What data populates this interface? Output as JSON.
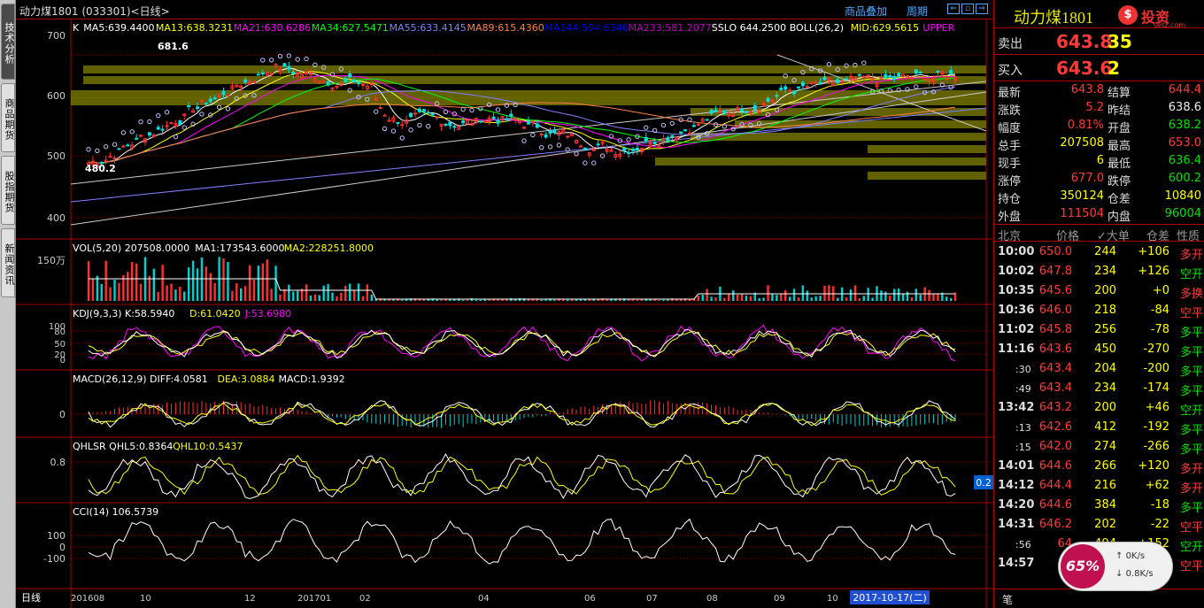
{
  "left_tabs": [
    "技术分析",
    "商品期货",
    "股指期货",
    "新闻资讯"
  ],
  "chart": {
    "title": "动力煤1801 (033301)<日线>",
    "links": [
      "商品叠加",
      "周期"
    ],
    "ma_legend": [
      {
        "text": "K",
        "color": "#ffffff"
      },
      {
        "text": "MA5:639.4400",
        "color": "#ffffff"
      },
      {
        "text": "MA13:638.3231",
        "color": "#ffff00"
      },
      {
        "text": "MA21:630.6286",
        "color": "#ff00ff"
      },
      {
        "text": "MA34:627.5471",
        "color": "#00ff00"
      },
      {
        "text": "MA55:633.4145",
        "color": "#8080ff"
      },
      {
        "text": "MA89:615.4360",
        "color": "#ff8040"
      },
      {
        "text": "MA144:594.6346",
        "color": "#0000ff"
      },
      {
        "text": "MA233:581.2077",
        "color": "#c000c0"
      },
      {
        "text": "SSLO 644.2500",
        "color": "#ffffff"
      },
      {
        "text": "BOLL(26,2)",
        "color": "#ffffff"
      },
      {
        "text": "MID:629.5615",
        "color": "#ffff00"
      },
      {
        "text": "UPPER",
        "color": "#ff00ff"
      }
    ],
    "price_axis": [
      "700",
      "600",
      "500",
      "400"
    ],
    "price_marks": {
      "high": "681.6",
      "low": "480.2"
    },
    "vol_legend": [
      {
        "text": "VOL(5,20) 207508.0000",
        "color": "#ffffff"
      },
      {
        "text": "MA1:173543.6000",
        "color": "#ffffff"
      },
      {
        "text": "MA2:228251.8000",
        "color": "#ffff00"
      }
    ],
    "vol_axis": "150万",
    "kdj_legend": [
      {
        "text": "KDJ(9,3,3) K:58.5940",
        "color": "#ffffff"
      },
      {
        "text": "D:61.0420",
        "color": "#ffff00"
      },
      {
        "text": "J:53.6980",
        "color": "#ff00ff"
      }
    ],
    "kdj_axis": [
      "100",
      "80",
      "50",
      "20",
      "0"
    ],
    "macd_legend": [
      {
        "text": "MACD(26,12,9) DIFF:4.0581",
        "color": "#ffffff"
      },
      {
        "text": "DEA:3.0884",
        "color": "#ffff00"
      },
      {
        "text": "MACD:1.9392",
        "color": "#ffffff"
      }
    ],
    "macd_axis": "0",
    "qhlsr_legend": [
      {
        "text": "QHLSR QHL5:0.8364",
        "color": "#ffffff"
      },
      {
        "text": "QHL10:0.5437",
        "color": "#ffff00"
      }
    ],
    "qhlsr_axis": "0.8",
    "qhlsr_marker": "0.2",
    "cci_legend": [
      {
        "text": "CCI(14) 106.5739",
        "color": "#ffffff"
      }
    ],
    "cci_axis": [
      "100",
      "0",
      "-100"
    ],
    "date_axis_label": "日线",
    "date_ticks": [
      "201608",
      "10",
      "12",
      "201701",
      "02",
      "04",
      "06",
      "07",
      "08",
      "09",
      "10"
    ],
    "date_highlight": "2017-10-17(二)"
  },
  "quote": {
    "name": "动力煤1801",
    "logo_brand": "投资",
    "logo_sub": "setz.com",
    "sell": {
      "label": "卖出",
      "price": "643.8",
      "vol": "35"
    },
    "buy": {
      "label": "买入",
      "price": "643.6",
      "vol": "2"
    },
    "stats": [
      {
        "l1": "最新",
        "v1": "643.8",
        "c1": "red",
        "l2": "结算",
        "v2": "644.4",
        "c2": "red"
      },
      {
        "l1": "涨跌",
        "v1": "5.2",
        "c1": "red",
        "l2": "昨结",
        "v2": "638.6",
        "c2": "white"
      },
      {
        "l1": "幅度",
        "v1": "0.81%",
        "c1": "red",
        "l2": "开盘",
        "v2": "638.2",
        "c2": "green"
      },
      {
        "l1": "总手",
        "v1": "207508",
        "c1": "yellow",
        "l2": "最高",
        "v2": "653.0",
        "c2": "red"
      },
      {
        "l1": "现手",
        "v1": "6",
        "c1": "yellow",
        "l2": "最低",
        "v2": "636.4",
        "c2": "green"
      },
      {
        "l1": "涨停",
        "v1": "677.0",
        "c1": "red",
        "l2": "跌停",
        "v2": "600.2",
        "c2": "green"
      },
      {
        "l1": "持仓",
        "v1": "350124",
        "c1": "yellow",
        "l2": "仓差",
        "v2": "10840",
        "c2": "yellow"
      },
      {
        "l1": "外盘",
        "v1": "111504",
        "c1": "red",
        "l2": "内盘",
        "v2": "96004",
        "c2": "green"
      }
    ],
    "trade_header": [
      "北京",
      "价格",
      "✓大单",
      "仓差",
      "性质"
    ],
    "trades": [
      {
        "t": "10:00",
        "s": false,
        "p": "650.0",
        "pc": "red",
        "v": "244",
        "d": "+106",
        "dc": "yellow",
        "n": "多开",
        "nc": "red"
      },
      {
        "t": "10:02",
        "s": false,
        "p": "647.8",
        "pc": "red",
        "v": "234",
        "d": "+126",
        "dc": "yellow",
        "n": "空开",
        "nc": "green"
      },
      {
        "t": "10:35",
        "s": false,
        "p": "645.6",
        "pc": "red",
        "v": "200",
        "d": "+0",
        "dc": "yellow",
        "n": "多换",
        "nc": "red"
      },
      {
        "t": "10:36",
        "s": false,
        "p": "646.0",
        "pc": "red",
        "v": "218",
        "d": "-84",
        "dc": "yellow",
        "n": "空平",
        "nc": "red"
      },
      {
        "t": "11:02",
        "s": false,
        "p": "645.8",
        "pc": "red",
        "v": "256",
        "d": "-78",
        "dc": "yellow",
        "n": "多平",
        "nc": "green"
      },
      {
        "t": "11:16",
        "s": false,
        "p": "643.6",
        "pc": "red",
        "v": "450",
        "d": "-270",
        "dc": "yellow",
        "n": "多平",
        "nc": "green"
      },
      {
        "t": ":30",
        "s": true,
        "p": "643.4",
        "pc": "red",
        "v": "204",
        "d": "-200",
        "dc": "yellow",
        "n": "多平",
        "nc": "green"
      },
      {
        "t": ":49",
        "s": true,
        "p": "643.4",
        "pc": "red",
        "v": "234",
        "d": "-174",
        "dc": "yellow",
        "n": "多平",
        "nc": "green"
      },
      {
        "t": "13:42",
        "s": false,
        "p": "643.2",
        "pc": "red",
        "v": "200",
        "d": "+46",
        "dc": "yellow",
        "n": "空开",
        "nc": "green"
      },
      {
        "t": ":13",
        "s": true,
        "p": "642.6",
        "pc": "red",
        "v": "412",
        "d": "-192",
        "dc": "yellow",
        "n": "多平",
        "nc": "green"
      },
      {
        "t": ":15",
        "s": true,
        "p": "642.0",
        "pc": "red",
        "v": "274",
        "d": "-266",
        "dc": "yellow",
        "n": "多平",
        "nc": "green"
      },
      {
        "t": "14:01",
        "s": false,
        "p": "644.6",
        "pc": "red",
        "v": "266",
        "d": "+120",
        "dc": "yellow",
        "n": "多开",
        "nc": "red"
      },
      {
        "t": "14:12",
        "s": false,
        "p": "644.4",
        "pc": "red",
        "v": "216",
        "d": "+62",
        "dc": "yellow",
        "n": "多开",
        "nc": "red"
      },
      {
        "t": "14:20",
        "s": false,
        "p": "644.6",
        "pc": "red",
        "v": "384",
        "d": "-18",
        "dc": "yellow",
        "n": "多平",
        "nc": "green"
      },
      {
        "t": "14:31",
        "s": false,
        "p": "646.2",
        "pc": "red",
        "v": "202",
        "d": "-22",
        "dc": "yellow",
        "n": "空平",
        "nc": "red"
      },
      {
        "t": ":56",
        "s": true,
        "p": "64",
        "pc": "red",
        "v": "494",
        "d": "+152",
        "dc": "yellow",
        "n": "空开",
        "nc": "green"
      },
      {
        "t": "14:57",
        "s": false,
        "p": "6",
        "pc": "red",
        "v": "",
        "d": "8",
        "dc": "yellow",
        "n": "空平",
        "nc": "red"
      }
    ],
    "bottom_label": "笔"
  },
  "speed_widget": {
    "percent": "65%",
    "up": "0K/s",
    "down": "0.8K/s"
  }
}
